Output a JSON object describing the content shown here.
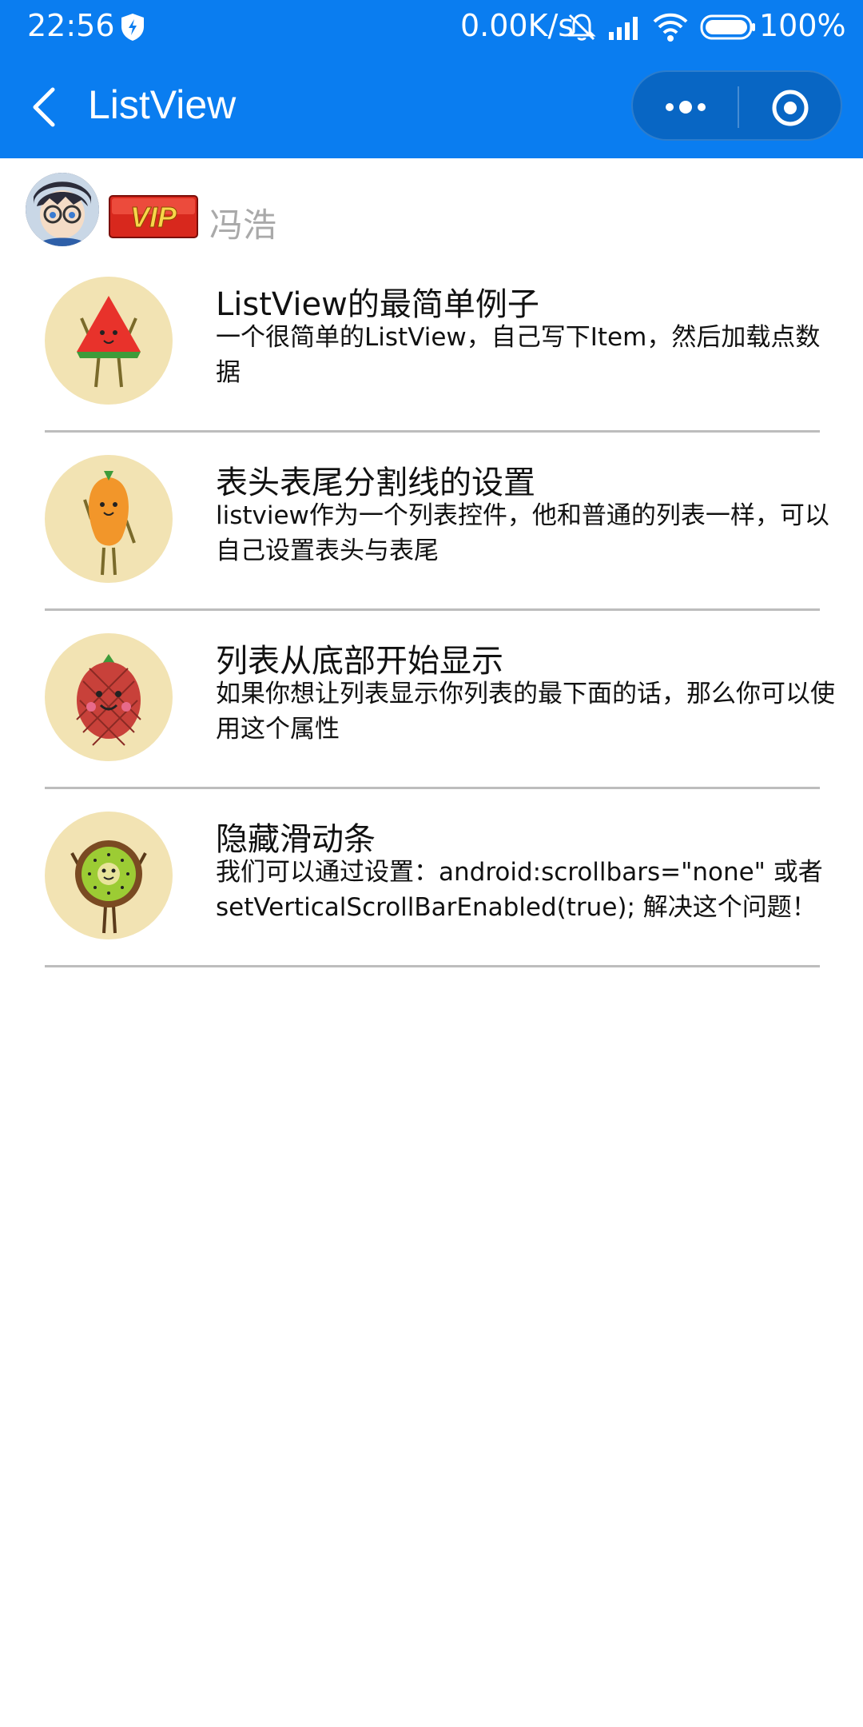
{
  "status_bar": {
    "time": "22:56",
    "net_speed": "0.00K/s",
    "battery": "100%"
  },
  "nav": {
    "title": "ListView",
    "accent": "#0a7df0"
  },
  "user": {
    "badge": "VIP",
    "name": "冯浩"
  },
  "list": {
    "items": [
      {
        "title": " ListView的最简单例子",
        "desc": "一个很简单的ListView，自己写下Item，然后加载点数据",
        "icon": "watermelon-icon"
      },
      {
        "title": "表头表尾分割线的设置",
        "desc": "listview作为一个列表控件，他和普通的列表一样，可以自己设置表头与表尾",
        "icon": "carrot-icon"
      },
      {
        "title": "列表从底部开始显示",
        "desc": "如果你想让列表显示你列表的最下面的话，那么你可以使用这个属性",
        "icon": "pineapple-icon"
      },
      {
        "title": "隐藏滑动条",
        "desc": "我们可以通过设置：android:scrollbars=\"none\" 或者 setVerticalScrollBarEnabled(true); 解决这个问题！",
        "icon": "kiwi-icon"
      }
    ]
  }
}
